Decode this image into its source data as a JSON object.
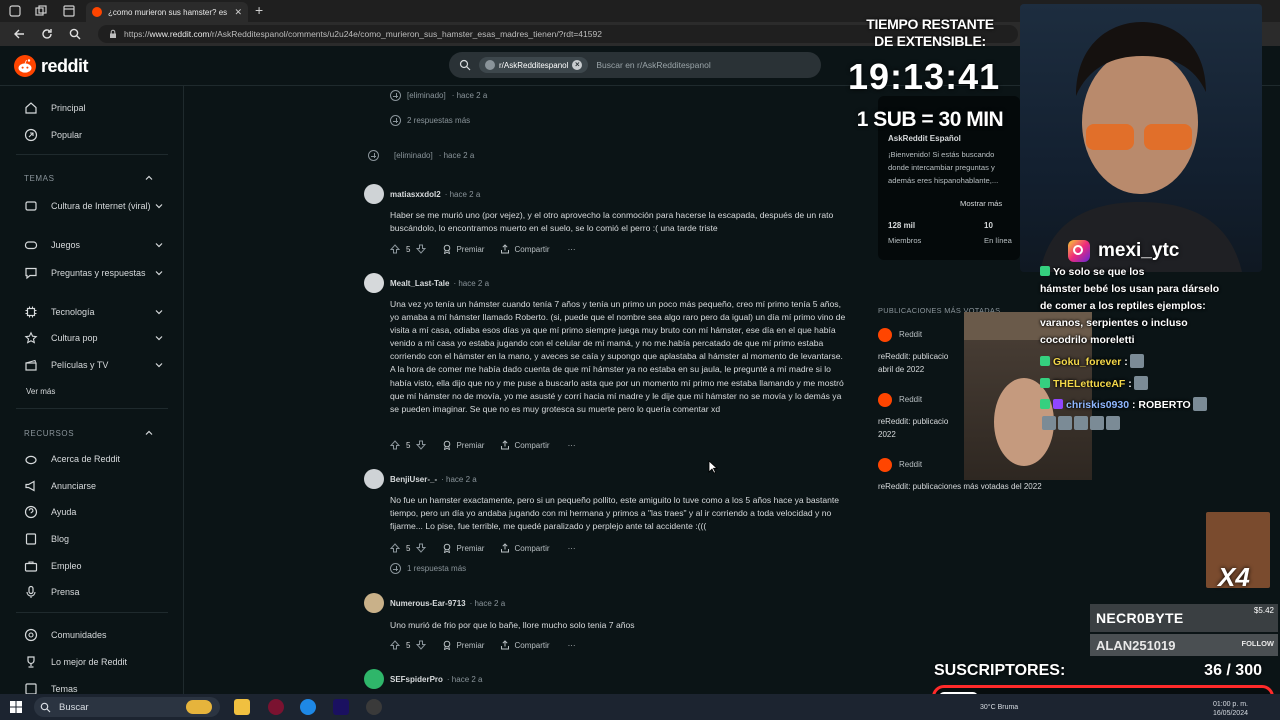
{
  "browser": {
    "tab_title": "¿como murieron sus hamster? es",
    "url_prefix": "https://",
    "url_host": "www.reddit.com",
    "url_path": "/r/AskRedditespanol/comments/u2u24e/como_murieron_sus_hamster_esas_madres_tienen/?rdt=41592"
  },
  "header": {
    "wordmark": "reddit",
    "search_chip": "r/AskRedditespanol",
    "search_placeholder": "Buscar en r/AskRedditespanol"
  },
  "sidebar": {
    "primary": [
      {
        "label": "Principal"
      },
      {
        "label": "Popular"
      }
    ],
    "topics_heading": "TEMAS",
    "topics": [
      {
        "label": "Cultura de Internet (viral)"
      },
      {
        "label": "Juegos"
      },
      {
        "label": "Preguntas y respuestas"
      },
      {
        "label": "Tecnología"
      },
      {
        "label": "Cultura pop"
      },
      {
        "label": "Películas y TV"
      }
    ],
    "see_more": "Ver más",
    "resources_heading": "RECURSOS",
    "resources": [
      {
        "label": "Acerca de Reddit"
      },
      {
        "label": "Anunciarse"
      },
      {
        "label": "Ayuda"
      },
      {
        "label": "Blog"
      },
      {
        "label": "Empleo"
      },
      {
        "label": "Prensa"
      }
    ],
    "extra": [
      {
        "label": "Comunidades"
      },
      {
        "label": "Lo mejor de Reddit"
      },
      {
        "label": "Temas"
      }
    ]
  },
  "comments": {
    "top_deleted": {
      "author": "[eliminado]",
      "time": "hace 2 a"
    },
    "top_more": "2 respuestas más",
    "second_deleted": {
      "author": "[eliminado]",
      "time": "hace 2 a"
    },
    "list": [
      {
        "author": "matiasxxdol2",
        "time": "hace 2 a",
        "body": "Haber se me murió uno (por vejez), y el otro aprovecho la conmoción para hacerse la escapada, después de un rato buscándolo, lo encontramos muerto en el suelo, se lo comió el perro :( una tarde triste",
        "votes": "5"
      },
      {
        "author": "Mealt_Last-Tale",
        "time": "hace 2 a",
        "body": "Una vez yo tenía un hámster cuando tenía 7 años y tenía un primo un poco más pequeño, creo mí primo tenía 5 años, yo amaba a mí hámster llamado Roberto. (si, puede que el nombre sea algo raro pero da igual) un día mí primo vino de visita a mí casa, odiaba esos días ya que mí primo siempre juega muy bruto con mí hámster, ese día en el que había venido a mí casa yo estaba jugando con el celular de mí mamá, y no me.había percatado de que mí primo estaba corriendo con el hámster en la mano, y aveces se caía y supongo que aplastaba al hámster al momento de levantarse. A la hora de comer me había dado cuenta de que mí hámster ya no estaba en su jaula, le pregunté a mí madre si lo había visto, ella dijo que no y me puse a buscarlo asta que por un momento mí primo me estaba llamando y me mostró que mí hámster no de movía, yo me asusté y corrí hacia mí madre y le dije que mí hámster no se movía y lo demás ya se pueden imaginar. Se que no es muy grotesca su muerte pero lo quería comentar xd",
        "votes": "5"
      },
      {
        "author": "BenjiUser-_-",
        "time": "hace 2 a",
        "body": "No fue un hamster exactamente, pero si un pequeño pollito, este amiguito lo tuve como a los 5 años hace ya bastante tiempo, pero un día yo andaba jugando con mi hermana y primos a \"las traes\" y al ir corriendo a toda velocidad y no fijarme... Lo pise, fue terrible, me quedé paralizado y perplejo ante tal accidente :(((",
        "votes": "5",
        "more": "1 respuesta más"
      },
      {
        "author": "Numerous-Ear-9713",
        "time": "hace 2 a",
        "body": "Uno murió de frio por que lo bañe, llore mucho solo tenia 7 años",
        "votes": "5"
      },
      {
        "author": "SEFspiderPro",
        "time": "hace 2 a"
      }
    ],
    "award_label": "Premiar",
    "share_label": "Compartir",
    "overflow_label": "···"
  },
  "right_panel": {
    "title": "AskReddit Español",
    "desc_1": "¡Bienvenido! Si estás buscando",
    "desc_2": "donde intercambiar preguntas y",
    "desc_3": "además eres hispanohablante,...",
    "show_more": "Mostrar más",
    "members_count": "128 mil",
    "members_label": "Miembros",
    "online_count": "10",
    "online_label": "En línea",
    "popular_heading": "PUBLICACIONES MÁS VOTADAS",
    "popular": [
      {
        "name": "Reddit",
        "title_1": "reReddit: publicacio",
        "title_2": "abril de 2022"
      },
      {
        "name": "Reddit",
        "title_1": "reReddit: publicacio",
        "title_2": "2022"
      },
      {
        "name": "Reddit",
        "title_1": "reReddit: publicaciones más votadas del 2022",
        "title_2": ""
      }
    ]
  },
  "stream": {
    "timer_label_1": "TIEMPO RESTANTE",
    "timer_label_2": "DE EXTENSIBLE:",
    "timer_value": "19:13:41",
    "timer_rule": "1 SUB = 30 MIN",
    "instagram": "mexi_ytc",
    "chat": [
      {
        "user": "",
        "text": "Yo solo se que los"
      },
      {
        "user": "",
        "text": "hámster bebé los usan para dárselo"
      },
      {
        "user": "",
        "text": "de comer a los reptiles ejemplos:"
      },
      {
        "user": "",
        "text": "varanos, serpientes o incluso"
      },
      {
        "user": "",
        "text": "cocodrilo moreletti"
      },
      {
        "user": "Goku_forever",
        "text": " :"
      },
      {
        "user": "THELettuceAF",
        "text": " :"
      },
      {
        "user": "chriskis0930",
        "text": " : ROBERTO"
      }
    ],
    "emote_multiplier": "X4",
    "alert_name": "NECR0BYTE",
    "alert_amount": "$5.42",
    "alert_follow_name": "ALAN251019",
    "alert_follow_label": "FOLLOW",
    "sub_goal_label": "SUSCRIPTORES:",
    "sub_goal_count": "36  / 300",
    "sub_goal_current": 36,
    "sub_goal_target": 300
  },
  "taskbar": {
    "search_label": "Buscar",
    "weather": "30°C  Bruma",
    "time": "01:00 p. m.",
    "date": "16/05/2024"
  },
  "colors": {
    "reddit_orange": "#ff4500",
    "background": "#0b1416",
    "goal_border": "#ff2a2a"
  }
}
